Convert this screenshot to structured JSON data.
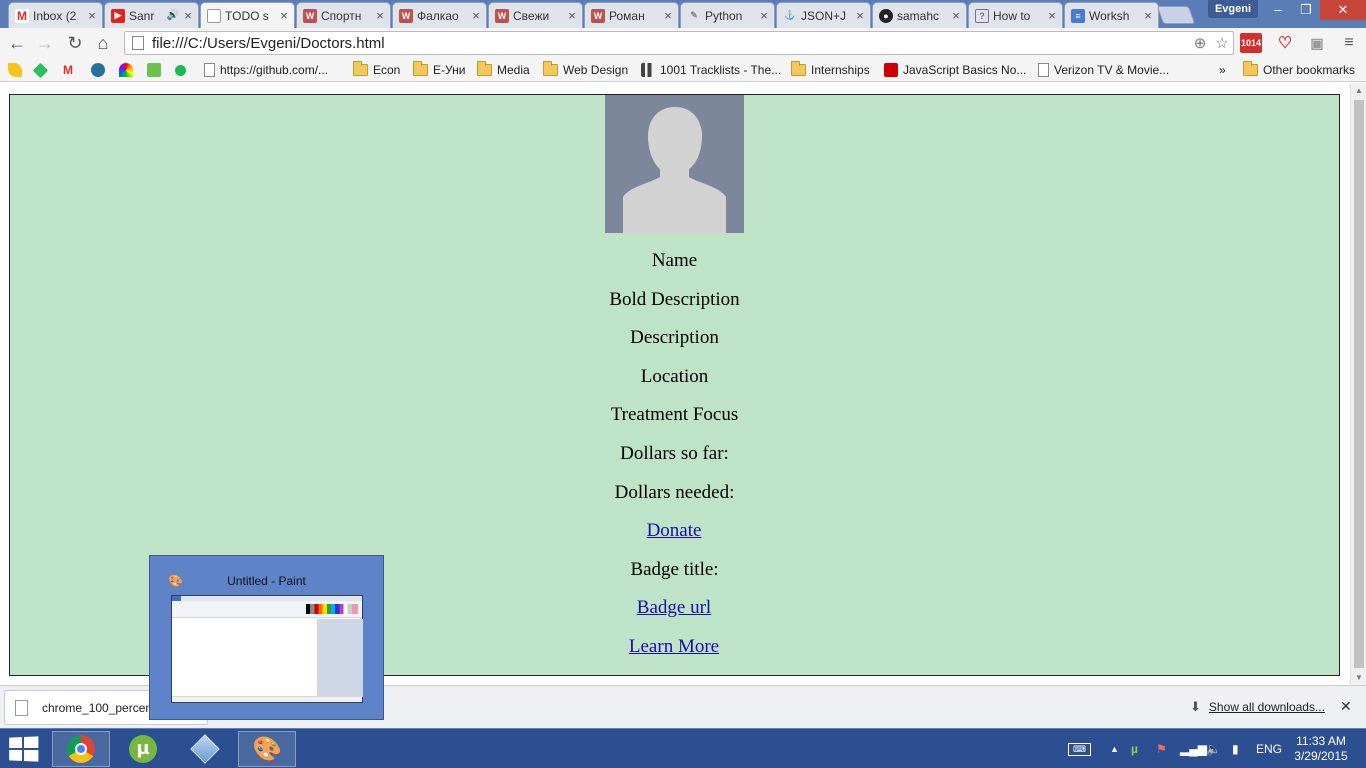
{
  "browser": {
    "profile_name": "Evgeni",
    "url": "file:///C:/Users/Evgeni/Doctors.html",
    "tabs": [
      {
        "title": "Inbox (2",
        "icon": "gmail-icon",
        "color": "#d93025"
      },
      {
        "title": "Sanr",
        "icon": "youtube-icon",
        "color": "#e62117"
      },
      {
        "title": "TODO s",
        "icon": "page-icon",
        "color": "#9aa0a6"
      },
      {
        "title": "Спортн",
        "icon": "site-icon",
        "color": "#c0504d"
      },
      {
        "title": "Фалкао",
        "icon": "site-icon",
        "color": "#c0504d"
      },
      {
        "title": "Свежи",
        "icon": "site-icon",
        "color": "#c0504d"
      },
      {
        "title": "Роман",
        "icon": "site-icon",
        "color": "#c0504d"
      },
      {
        "title": "Python",
        "icon": "python-icon",
        "color": "#b0b0b0"
      },
      {
        "title": "JSON+J",
        "icon": "json-icon",
        "color": "#c8a060"
      },
      {
        "title": "samahc",
        "icon": "github-icon",
        "color": "#222222"
      },
      {
        "title": "How to",
        "icon": "howto-icon",
        "color": "#7a6a9a"
      },
      {
        "title": "Worksh",
        "icon": "docs-icon",
        "color": "#4a7bd3"
      }
    ],
    "bookmarks": [
      {
        "label": "https://github.com/...",
        "type": "page"
      },
      {
        "label": "Econ",
        "type": "folder"
      },
      {
        "label": "Е-Уни",
        "type": "folder"
      },
      {
        "label": "Media",
        "type": "folder"
      },
      {
        "label": "Web Design",
        "type": "folder"
      },
      {
        "label": "1001 Tracklists - The...",
        "type": "page"
      },
      {
        "label": "Internships",
        "type": "folder"
      },
      {
        "label": "JavaScript Basics No...",
        "type": "youtube"
      },
      {
        "label": "Verizon TV & Movie...",
        "type": "page"
      }
    ],
    "bookmarks_overflow": "»",
    "other_bookmarks": "Other bookmarks",
    "ext_badge": "1014"
  },
  "page": {
    "name": "Name",
    "bold_description": "Bold Description",
    "description": "Description",
    "location": "Location",
    "treatment_focus": "Treatment Focus",
    "dollars_so_far": "Dollars so far:",
    "dollars_needed": "Dollars needed:",
    "donate": "Donate",
    "badge_title": "Badge title:",
    "badge_url": "Badge url",
    "learn_more": "Learn More"
  },
  "download_shelf": {
    "file_name": "chrome_100_percent",
    "show_all": "Show all downloads..."
  },
  "paint_preview": {
    "title": "Untitled - Paint"
  },
  "taskbar": {
    "language": "ENG",
    "time": "11:33 AM",
    "date": "3/29/2015"
  }
}
